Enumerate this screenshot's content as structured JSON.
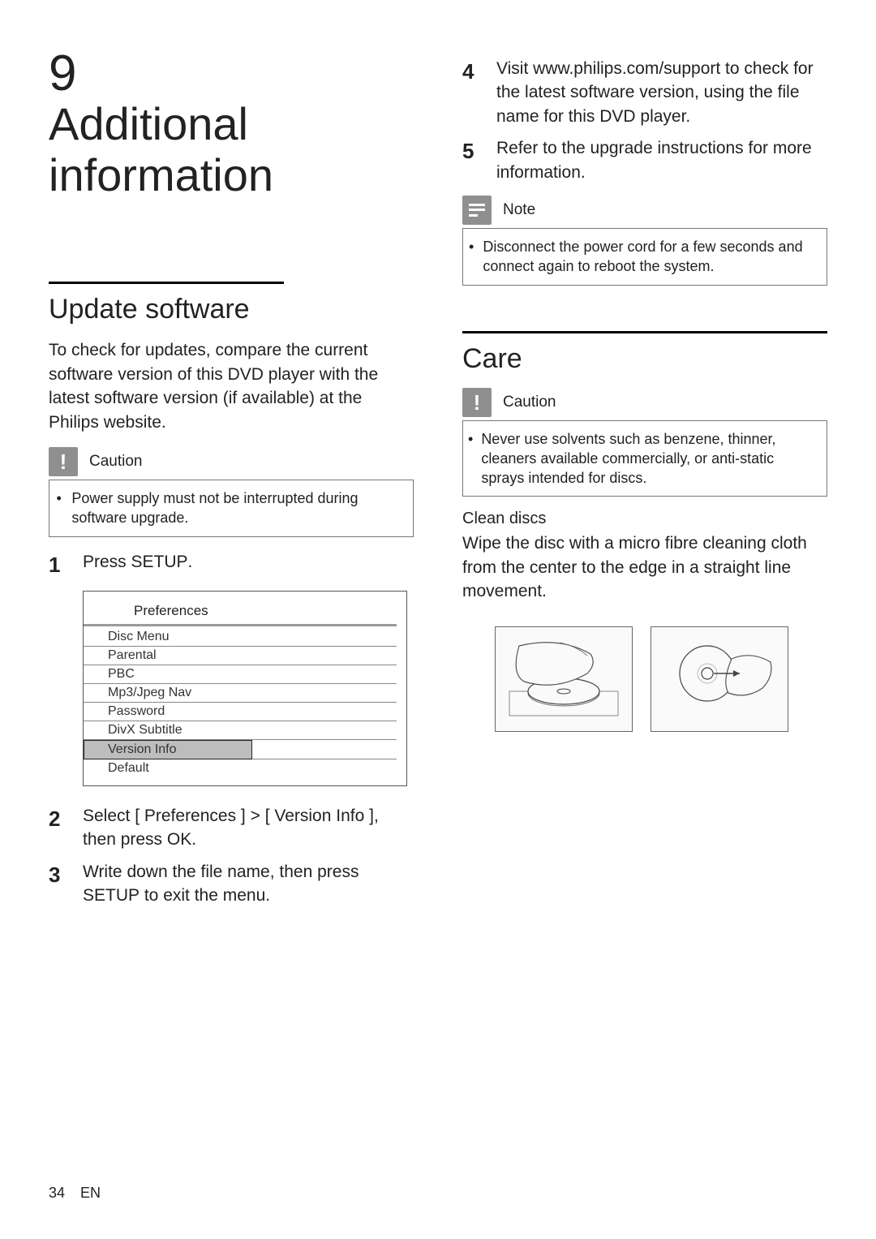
{
  "chapter": {
    "number": "9",
    "title": "Additional information"
  },
  "update": {
    "section_title": "Update software",
    "intro": "To check for updates, compare the current software version of this DVD player with the latest software version (if available) at the Philips website.",
    "caution_label": "Caution",
    "caution_text": "Power supply must not be interrupted during software upgrade.",
    "step1_pre": "Press ",
    "step1_key": "SETUP",
    "step1_post": ".",
    "step2_pre": "Select ",
    "step2_a": "[ Preferences ]",
    "step2_gt": " > ",
    "step2_b": "[ Version Info ]",
    "step2_mid": ", then press ",
    "step2_key": "OK",
    "step2_post": ".",
    "step3_pre": "Write down the file name, then press ",
    "step3_key": "SETUP",
    "step3_post": " to exit the menu.",
    "step4": "Visit www.philips.com/support to check for the latest software version, using the file name for this DVD player.",
    "step5": "Refer to the upgrade instructions for more information.",
    "note_label": "Note",
    "note_text": "Disconnect the power cord for a few seconds and connect again to reboot the system."
  },
  "menu": {
    "header": "Preferences",
    "items": [
      {
        "label": "Disc Menu",
        "selected": false
      },
      {
        "label": "Parental",
        "selected": false
      },
      {
        "label": "PBC",
        "selected": false
      },
      {
        "label": "Mp3/Jpeg Nav",
        "selected": false
      },
      {
        "label": "Password",
        "selected": false
      },
      {
        "label": "DivX Subtitle",
        "selected": false
      },
      {
        "label": "Version Info",
        "selected": true
      },
      {
        "label": "Default",
        "selected": false
      }
    ]
  },
  "care": {
    "section_title": "Care",
    "caution_label": "Caution",
    "caution_text": "Never use solvents such as benzene, thinner, cleaners available commercially, or anti-static sprays intended for discs.",
    "clean_heading": "Clean discs",
    "clean_text": "Wipe the disc with a micro fibre cleaning cloth from the center to the edge in a straight line movement."
  },
  "footer": {
    "page": "34",
    "lang": "EN"
  }
}
